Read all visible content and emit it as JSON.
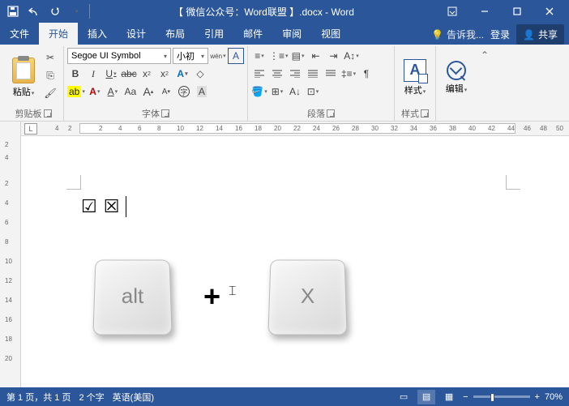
{
  "titlebar": {
    "title": "【 微信公众号：Word联盟 】.docx - Word"
  },
  "tabs": {
    "file": "文件",
    "home": "开始",
    "insert": "插入",
    "design": "设计",
    "layout": "布局",
    "references": "引用",
    "mail": "邮件",
    "review": "审阅",
    "view": "视图",
    "tell": "告诉我...",
    "login": "登录",
    "share": "共享"
  },
  "ribbon": {
    "clipboard": {
      "paste": "粘贴",
      "label": "剪贴板"
    },
    "font": {
      "name": "Segoe UI Symbol",
      "size": "小初",
      "label": "字体"
    },
    "paragraph": {
      "label": "段落"
    },
    "styles": {
      "btn": "样式",
      "label": "样式"
    },
    "editing": {
      "btn": "编辑"
    }
  },
  "ruler": {
    "L": "L",
    "h": [
      "4",
      "2",
      "2",
      "4",
      "6",
      "8",
      "10",
      "12",
      "14",
      "16",
      "18",
      "20",
      "22",
      "24",
      "26",
      "28",
      "30",
      "32",
      "34",
      "36",
      "38",
      "40",
      "42",
      "44",
      "46",
      "48",
      "50"
    ],
    "v": [
      "2",
      "4",
      "2",
      "4",
      "6",
      "8",
      "10",
      "12",
      "14",
      "16",
      "18",
      "20"
    ]
  },
  "doc": {
    "sym1": "☑",
    "sym2": "☒",
    "key1": "alt",
    "plus": "+",
    "key2": "X"
  },
  "status": {
    "page": "第 1 页，共 1 页",
    "words": "2 个字",
    "lang": "英语(美国)",
    "zminus": "−",
    "zplus": "+",
    "zoom": "70%"
  }
}
